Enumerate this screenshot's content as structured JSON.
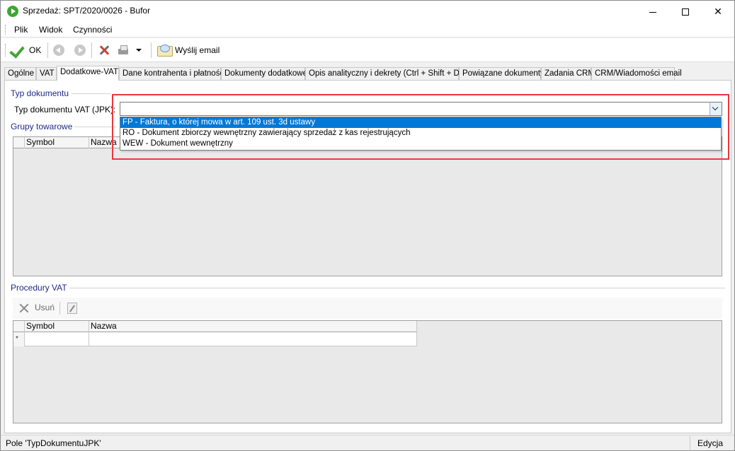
{
  "window": {
    "title": "Sprzedaż: SPT/2020/0026 - Bufor"
  },
  "menu": [
    "Plik",
    "Widok",
    "Czynności"
  ],
  "toolbar": {
    "ok_label": "OK",
    "email_label": "Wyślij email"
  },
  "tabs": [
    "Ogólne",
    "VAT",
    "Dodatkowe-VAT",
    "Dane kontrahenta i płatności",
    "Dokumenty dodatkowe",
    "Opis analityczny i dekrety (Ctrl + Shift + D)",
    "Powiązane dokumenty",
    "Zadania CRM",
    "CRM/Wiadomości email"
  ],
  "active_tab": "Dodatkowe-VAT",
  "typ_dokumentu": {
    "group_label": "Typ dokumentu",
    "field_label": "Typ dokumentu VAT (JPK):",
    "value": "",
    "options": [
      "FP - Faktura, o której mowa w art. 109 ust. 3d ustawy",
      "RO - Dokument zbiorczy wewnętrzny zawierający sprzedaż z kas rejestrujących",
      "WEW - Dokument wewnętrzny"
    ],
    "highlighted_option": 0
  },
  "grupy_towarowe": {
    "group_label": "Grupy towarowe",
    "columns": [
      "Symbol",
      "Nazwa"
    ]
  },
  "procedury_vat": {
    "group_label": "Procedury VAT",
    "delete_label": "Usuń",
    "columns": [
      "Symbol",
      "Nazwa"
    ],
    "new_row_marker": "*"
  },
  "status": {
    "left": "Pole 'TypDokumentuJPK'",
    "right": "Edycja"
  },
  "colors": {
    "accent_blue": "#0078d7",
    "group_label": "#1e2a8a",
    "highlight_red": "#e8383d",
    "ok_green": "#3fa535"
  }
}
